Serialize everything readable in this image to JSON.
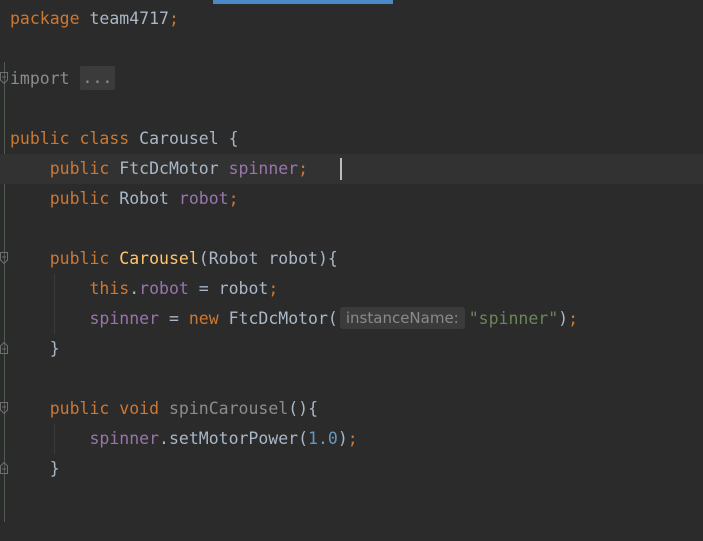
{
  "code": {
    "line1": {
      "kw_package": "package",
      "pkg_name": "team4717",
      "semi": ";"
    },
    "line3": {
      "kw_import": "import",
      "folded": "..."
    },
    "line5": {
      "kw_public": "public",
      "kw_class": "class",
      "class_name": "Carousel",
      "brace": "{"
    },
    "line6": {
      "kw_public": "public",
      "type": "FtcDcMotor",
      "field": "spinner",
      "semi": ";"
    },
    "line7": {
      "kw_public": "public",
      "type": "Robot",
      "field": "robot",
      "semi": ";"
    },
    "line9": {
      "kw_public": "public",
      "ctor": "Carousel",
      "params": "(Robot robot){"
    },
    "line10": {
      "kw_this": "this",
      "dot": ".",
      "field": "robot",
      "rest": " = robot",
      "semi": ";"
    },
    "line11": {
      "field": "spinner",
      "eq": " = ",
      "kw_new": "new",
      "ctor_call": " FtcDcMotor(",
      "hint": "instanceName:",
      "string": "\"spinner\"",
      "close": ")",
      "semi": ";"
    },
    "line12": {
      "brace": "}"
    },
    "line14": {
      "kw_public": "public",
      "kw_void": "void",
      "method": "spinCarousel",
      "rest": "(){"
    },
    "line15": {
      "field": "spinner",
      "call": ".setMotorPower(",
      "num": "1.0",
      "close": ")",
      "semi": ";"
    },
    "line16": {
      "brace": "}"
    }
  },
  "colors": {
    "background": "#2b2b2b",
    "keyword": "#cc7832",
    "field": "#9876aa",
    "method": "#ffc66d",
    "string": "#6a8759",
    "number": "#6897bb",
    "text": "#a9b7c6"
  }
}
